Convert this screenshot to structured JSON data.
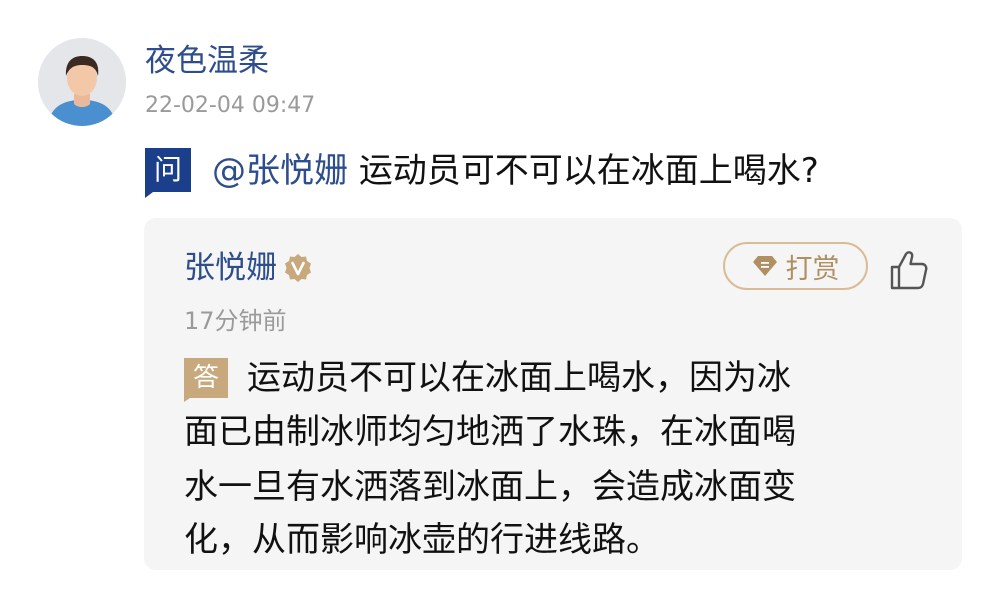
{
  "post": {
    "author_name": "夜色温柔",
    "timestamp": "22-02-04 09:47",
    "avatar_icon": "user-avatar"
  },
  "question": {
    "badge": "问",
    "mention": "@张悦姗",
    "text": "运动员可不可以在冰面上喝水?"
  },
  "answer": {
    "author_name": "张悦姗",
    "verified_icon": "verified-v-badge",
    "tip_label": "打赏",
    "tip_icon": "gem-icon",
    "like_icon": "thumbs-up-icon",
    "time": "17分钟前",
    "badge": "答",
    "lines": [
      "运动员不可以在冰面上喝水，因为冰",
      "面已由制冰师均匀地洒了水珠，在冰面喝",
      "水一旦有水洒落到冰面上，会造成冰面变",
      "化，从而影响冰壶的行进线路。"
    ]
  },
  "colors": {
    "name_blue": "#2e4d8c",
    "question_badge": "#1b3f8b",
    "answer_badge": "#c8a97e",
    "tip_border": "#d9bc95",
    "card_background": "#f5f5f5",
    "meta_gray": "#9a9a9a"
  }
}
